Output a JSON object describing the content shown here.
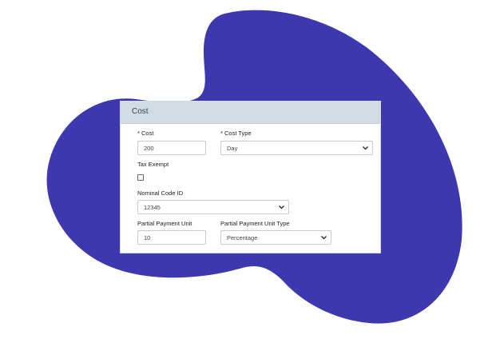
{
  "panel": {
    "title": "Cost"
  },
  "fields": {
    "cost": {
      "label": "* Cost",
      "value": "200"
    },
    "cost_type": {
      "label": "* Cost Type",
      "value": "Day"
    },
    "tax_exempt": {
      "label": "Tax Exempt",
      "checked": false
    },
    "nominal_code": {
      "label": "Nominal Code ID",
      "value": "12345"
    },
    "partial_payment_unit": {
      "label": "Partial Payment Unit",
      "value": "10"
    },
    "partial_payment_unit_type": {
      "label": "Partial Payment Unit Type",
      "value": "Percentage"
    }
  },
  "colors": {
    "blob": "#3d37b0",
    "header_bg": "#d3dbe3",
    "page_bg": "#ffffff"
  },
  "icons": {
    "select_arrow": "chevron-down-icon"
  }
}
